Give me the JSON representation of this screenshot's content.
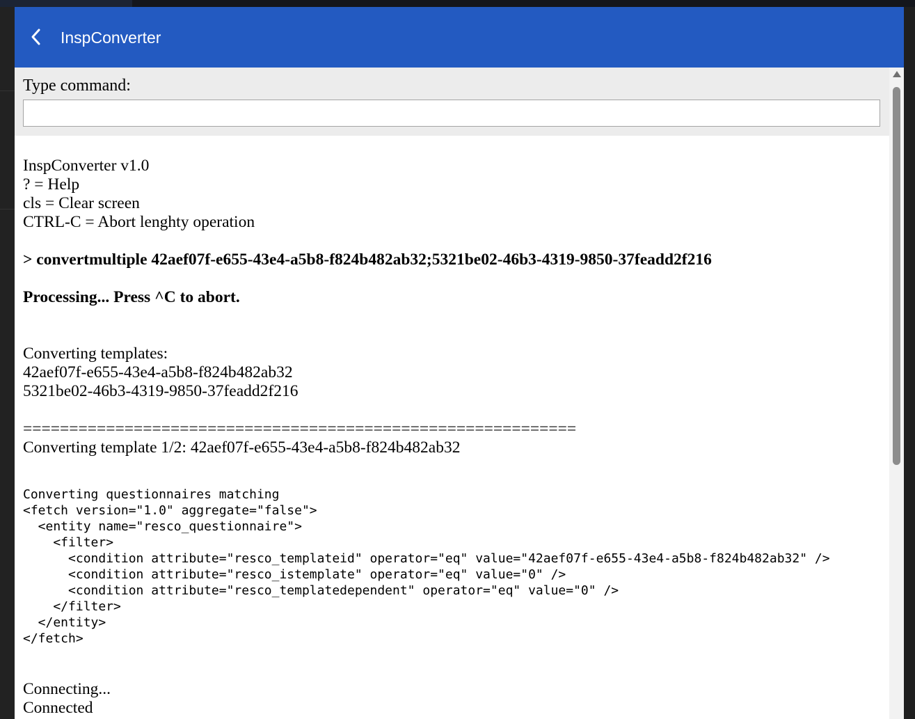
{
  "app": {
    "title": "InspConverter"
  },
  "command": {
    "label": "Type command:",
    "value": "",
    "placeholder": ""
  },
  "output": {
    "intro": [
      "InspConverter v1.0",
      "? = Help",
      "cls = Clear screen",
      "CTRL-C = Abort lenghty operation"
    ],
    "command_echo": "> convertmultiple 42aef07f-e655-43e4-a5b8-f824b482ab32;5321be02-46b3-4319-9850-37feadd2f216",
    "processing": "Processing... Press ^C to abort.",
    "converting_templates": "Converting templates:",
    "templates": [
      "42aef07f-e655-43e4-a5b8-f824b482ab32",
      "5321be02-46b3-4319-9850-37feadd2f216"
    ],
    "separator": "============================================================",
    "converting_template": "Converting template 1/2: 42aef07f-e655-43e4-a5b8-f824b482ab32",
    "fetch_lines": [
      "Converting questionnaires matching",
      "<fetch version=\"1.0\" aggregate=\"false\">",
      "  <entity name=\"resco_questionnaire\">",
      "    <filter>",
      "      <condition attribute=\"resco_templateid\" operator=\"eq\" value=\"42aef07f-e655-43e4-a5b8-f824b482ab32\" />",
      "      <condition attribute=\"resco_istemplate\" operator=\"eq\" value=\"0\" />",
      "      <condition attribute=\"resco_templatedependent\" operator=\"eq\" value=\"0\" />",
      "    </filter>",
      "  </entity>",
      "</fetch>"
    ],
    "connecting": "Connecting...",
    "connected": "Connected"
  },
  "icons": {
    "back": "chevron-left-icon",
    "scroll_up": "arrow-up-icon"
  },
  "colors": {
    "header": "#235ac1",
    "command_bar": "#ececec",
    "text": "#000000"
  }
}
